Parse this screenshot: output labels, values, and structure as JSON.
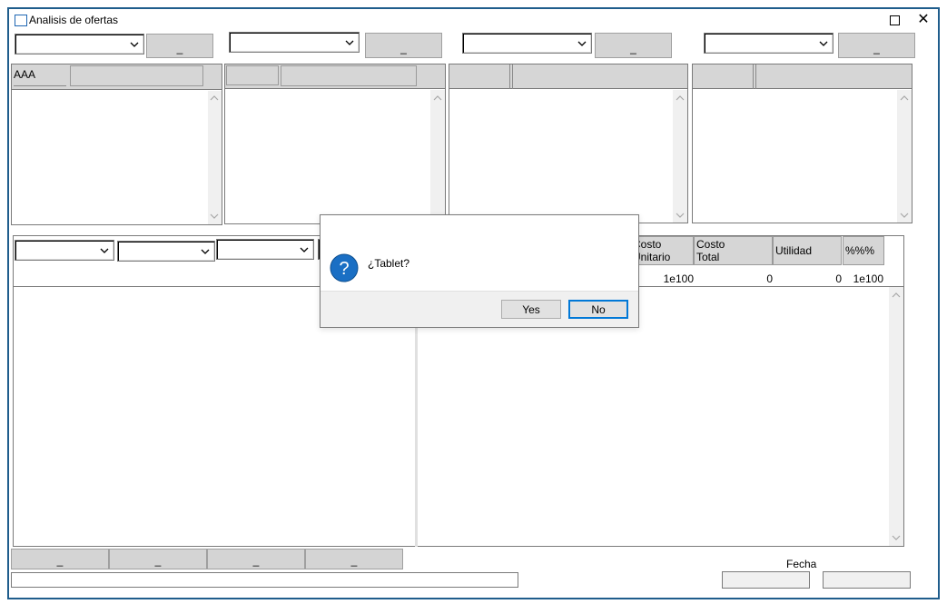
{
  "window": {
    "title": "Analisis de ofertas",
    "maximize_icon": "maximize-icon",
    "close_glyph": "✕"
  },
  "top_buttons": [
    "_",
    "_",
    "_",
    "_"
  ],
  "panel1": {
    "header_text": "AAA"
  },
  "grid": {
    "headers": [
      {
        "label": "Costo Unitario",
        "line1": "Costo",
        "line2": "Unitario"
      },
      {
        "label": "Costo Total",
        "line1": "Costo",
        "line2": "Total"
      },
      {
        "label": "Utilidad"
      },
      {
        "label": "%%%"
      }
    ],
    "row": [
      "1e100",
      "0",
      "0",
      "1e100"
    ]
  },
  "dialog": {
    "icon": "question-icon",
    "message": "¿Tablet?",
    "yes_label": "Yes",
    "no_label": "No"
  },
  "bottom_tabs": [
    "_",
    "_",
    "_",
    "_"
  ],
  "footer": {
    "fecha_label": "Fecha"
  },
  "colors": {
    "frame": "#1f5d8c",
    "accent": "#0078d7",
    "panel_gray": "#d6d6d6"
  }
}
